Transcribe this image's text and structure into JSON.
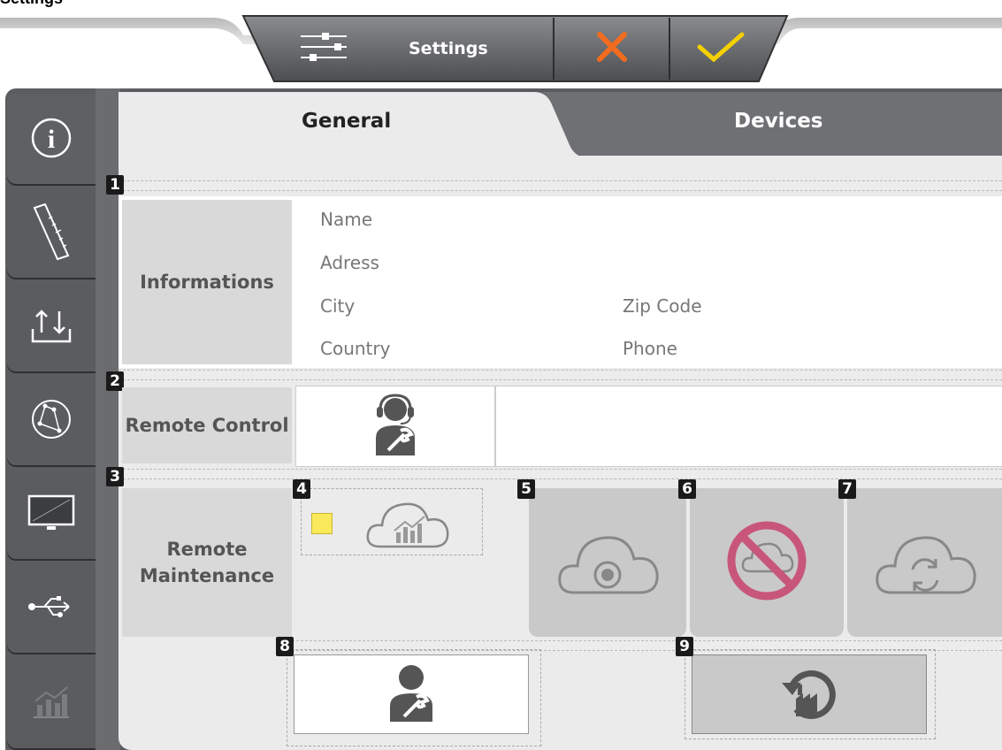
{
  "top_fragment": "Settings",
  "toolbar": {
    "settings_label": "Settings"
  },
  "tabs": {
    "general": "General",
    "devices": "Devices"
  },
  "sections": {
    "info": {
      "marker": "1",
      "label": "Informations",
      "fields": {
        "name": "Name",
        "address": "Adress",
        "city": "City",
        "zip": "Zip Code",
        "country": "Country",
        "phone": "Phone"
      }
    },
    "remote_control": {
      "marker": "2",
      "label": "Remote Control"
    },
    "remote_maintenance": {
      "marker": "3",
      "label_line1": "Remote",
      "label_line2": "Maintenance"
    }
  },
  "markers": {
    "m4": "4",
    "m5": "5",
    "m6": "6",
    "m7": "7",
    "m8": "8",
    "m9": "9"
  },
  "sidebar_icons": [
    "info-icon",
    "ruler-icon",
    "upload-download-icon",
    "network-globe-icon",
    "monitor-icon",
    "usb-icon",
    "chart-icon"
  ],
  "colors": {
    "accent_yellow": "#f5d000",
    "cancel_orange": "#f26c1f",
    "no_cloud_pink": "#c8567a",
    "panel_dark": "#5a5c5f"
  }
}
